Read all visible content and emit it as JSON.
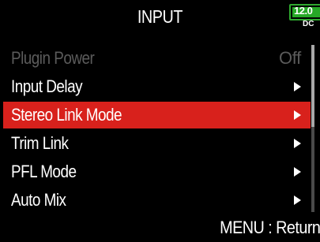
{
  "header": {
    "title": "INPUT",
    "battery_voltage": "12.0",
    "power_source": "DC"
  },
  "menu": {
    "items": [
      {
        "label": "Plugin Power",
        "value": "Off",
        "state": "disabled"
      },
      {
        "label": "Input Delay",
        "state": "normal"
      },
      {
        "label": "Stereo Link Mode",
        "state": "selected"
      },
      {
        "label": "Trim Link",
        "state": "normal"
      },
      {
        "label": "PFL Mode",
        "state": "normal"
      },
      {
        "label": "Auto Mix",
        "state": "normal"
      }
    ]
  },
  "colors": {
    "selection": "#d8211c",
    "battery": "#27a827",
    "disabled_text": "#5b5b5b"
  },
  "icons": {
    "submenu": "arrow-right-icon",
    "battery": "battery-icon"
  },
  "footer": {
    "hint": "MENU : Return"
  }
}
